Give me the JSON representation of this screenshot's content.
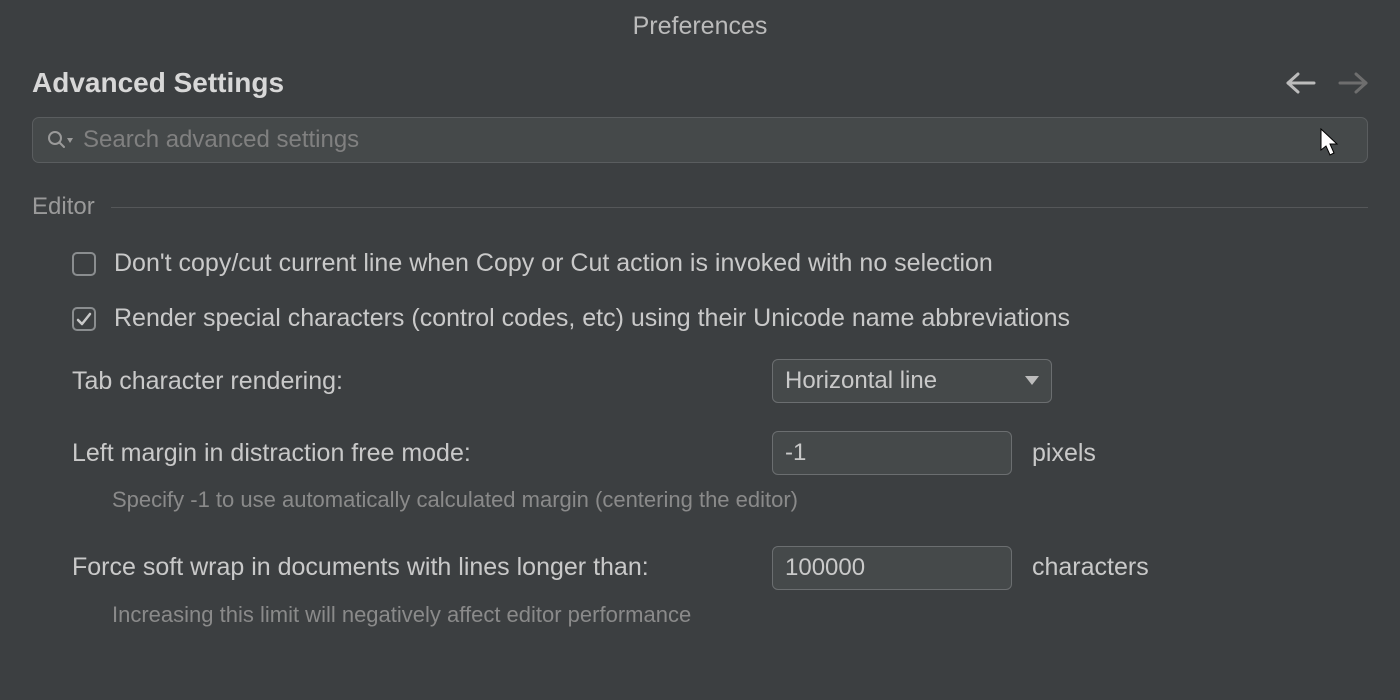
{
  "window_title": "Preferences",
  "page_title": "Advanced Settings",
  "search": {
    "placeholder": "Search advanced settings",
    "value": ""
  },
  "section": {
    "label": "Editor"
  },
  "settings": {
    "dont_copy_cut": {
      "label": "Don't copy/cut current line when Copy or Cut action is invoked with no selection",
      "checked": false
    },
    "render_special": {
      "label": "Render special characters (control codes, etc) using their Unicode name abbreviations",
      "checked": true
    },
    "tab_rendering": {
      "label": "Tab character rendering:",
      "value": "Horizontal line"
    },
    "left_margin": {
      "label": "Left margin in distraction free mode:",
      "value": "-1",
      "unit": "pixels",
      "hint": "Specify -1 to use automatically calculated margin (centering the editor)"
    },
    "soft_wrap": {
      "label": "Force soft wrap in documents with lines longer than:",
      "value": "100000",
      "unit": "characters",
      "hint": "Increasing this limit will negatively affect editor performance"
    }
  }
}
